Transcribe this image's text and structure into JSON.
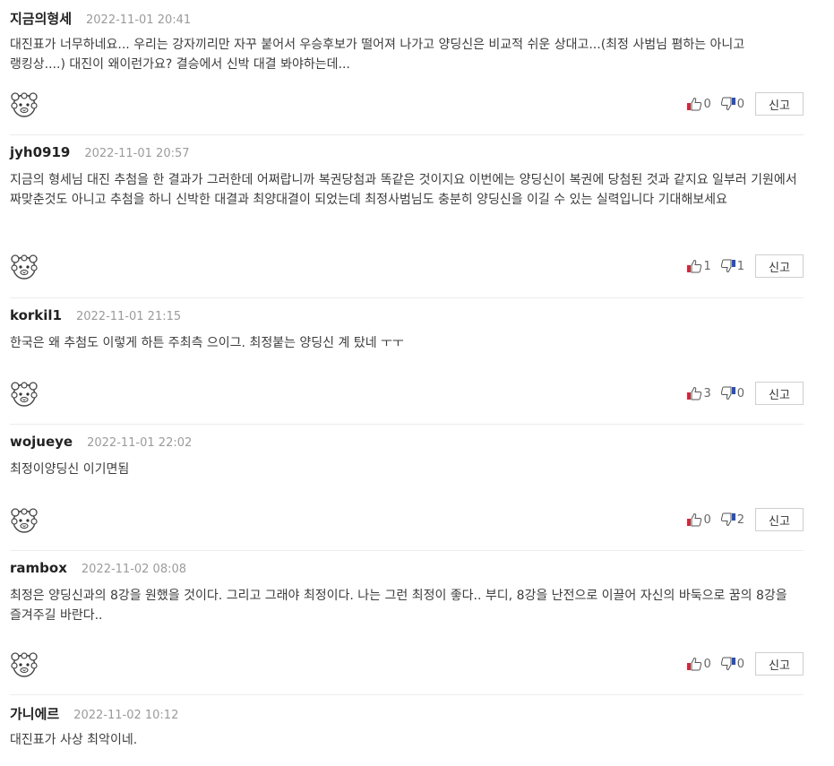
{
  "comments": [
    {
      "author": "지금의형세",
      "date": "2022-11-01 20:41",
      "text": "대진표가 너무하네요... 우리는 강자끼리만 자꾸 붙어서 우승후보가 떨어져 나가고 양딩신은 비교적 쉬운 상대고...(최정 사범님 폄하는 아니고 랭킹상....) 대진이 왜이런가요? 결승에서 신박 대결 봐야하는데...",
      "likes": "0",
      "dislikes": "0",
      "report_label": "신고"
    },
    {
      "author": "jyh0919",
      "date": "2022-11-01 20:57",
      "text": "지금의 형세님 대진 추첨을 한 결과가 그러한데 어쩌랍니까 복권당첨과 똑같은 것이지요 이번에는 양딩신이 복권에 당첨된 것과 같지요 일부러 기원에서 짜맞춘것도 아니고 추첨을 하니 신박한 대결과 최양대결이 되었는데 최정사범님도 충분히 양딩신을 이길 수 있는 실력입니다 기대해보세요",
      "likes": "1",
      "dislikes": "1",
      "report_label": "신고"
    },
    {
      "author": "korkil1",
      "date": "2022-11-01 21:15",
      "text": "한국은 왜 추첨도 이렇게 하튼 주최측 으이그. 최정붙는 양딩신 계 탔네 ㅜㅜ",
      "likes": "3",
      "dislikes": "0",
      "report_label": "신고"
    },
    {
      "author": "wojueye",
      "date": "2022-11-01 22:02",
      "text": "최정이양딩신 이기면됨",
      "likes": "0",
      "dislikes": "2",
      "report_label": "신고"
    },
    {
      "author": "rambox",
      "date": "2022-11-02 08:08",
      "text": "최정은 양딩신과의 8강을 원했을 것이다. 그리고 그래야 최정이다. 나는 그런 최정이 좋다.. 부디, 8강을 난전으로 이끌어 자신의 바둑으로 꿈의 8강을 즐겨주길 바란다..",
      "likes": "0",
      "dislikes": "0",
      "report_label": "신고"
    },
    {
      "author": "가니에르",
      "date": "2022-11-02 10:12",
      "text": "대진표가 사상 최악이네.",
      "likes": "",
      "dislikes": "",
      "report_label": ""
    }
  ],
  "icons": {
    "avatar": "sheep-avatar-icon",
    "like": "thumbs-up-icon",
    "dislike": "thumbs-down-icon"
  },
  "colors": {
    "like_accent": "#d0283a",
    "dislike_accent": "#2a4fb8"
  }
}
